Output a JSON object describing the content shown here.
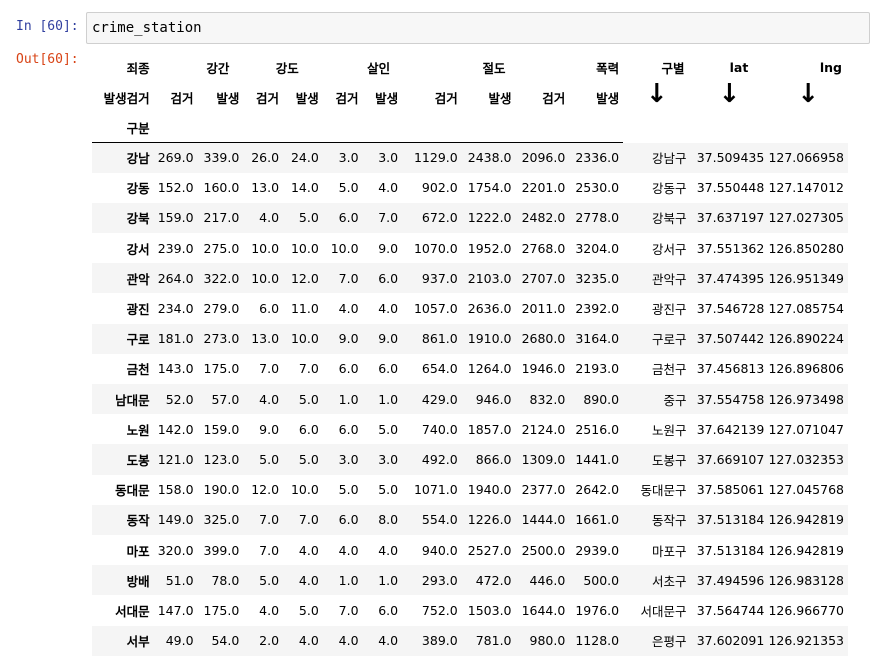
{
  "input": {
    "prompt": "In [60]:",
    "code": "crime_station"
  },
  "output": {
    "prompt": "Out[60]:"
  },
  "table": {
    "header_row1": [
      "죄종",
      "강간",
      "강도",
      "살인",
      "절도",
      "폭력",
      "구별",
      "lat",
      "lng"
    ],
    "header_row2": [
      "발생검거",
      "검거",
      "발생",
      "검거",
      "발생",
      "검거",
      "발생",
      "검거",
      "발생",
      "검거",
      "발생"
    ],
    "index_name": "구분",
    "arrow_glyph": "↓",
    "rows": [
      [
        "강남",
        "269.0",
        "339.0",
        "26.0",
        "24.0",
        "3.0",
        "3.0",
        "1129.0",
        "2438.0",
        "2096.0",
        "2336.0",
        "강남구",
        "37.509435",
        "127.066958"
      ],
      [
        "강동",
        "152.0",
        "160.0",
        "13.0",
        "14.0",
        "5.0",
        "4.0",
        "902.0",
        "1754.0",
        "2201.0",
        "2530.0",
        "강동구",
        "37.550448",
        "127.147012"
      ],
      [
        "강북",
        "159.0",
        "217.0",
        "4.0",
        "5.0",
        "6.0",
        "7.0",
        "672.0",
        "1222.0",
        "2482.0",
        "2778.0",
        "강북구",
        "37.637197",
        "127.027305"
      ],
      [
        "강서",
        "239.0",
        "275.0",
        "10.0",
        "10.0",
        "10.0",
        "9.0",
        "1070.0",
        "1952.0",
        "2768.0",
        "3204.0",
        "강서구",
        "37.551362",
        "126.850280"
      ],
      [
        "관악",
        "264.0",
        "322.0",
        "10.0",
        "12.0",
        "7.0",
        "6.0",
        "937.0",
        "2103.0",
        "2707.0",
        "3235.0",
        "관악구",
        "37.474395",
        "126.951349"
      ],
      [
        "광진",
        "234.0",
        "279.0",
        "6.0",
        "11.0",
        "4.0",
        "4.0",
        "1057.0",
        "2636.0",
        "2011.0",
        "2392.0",
        "광진구",
        "37.546728",
        "127.085754"
      ],
      [
        "구로",
        "181.0",
        "273.0",
        "13.0",
        "10.0",
        "9.0",
        "9.0",
        "861.0",
        "1910.0",
        "2680.0",
        "3164.0",
        "구로구",
        "37.507442",
        "126.890224"
      ],
      [
        "금천",
        "143.0",
        "175.0",
        "7.0",
        "7.0",
        "6.0",
        "6.0",
        "654.0",
        "1264.0",
        "1946.0",
        "2193.0",
        "금천구",
        "37.456813",
        "126.896806"
      ],
      [
        "남대문",
        "52.0",
        "57.0",
        "4.0",
        "5.0",
        "1.0",
        "1.0",
        "429.0",
        "946.0",
        "832.0",
        "890.0",
        "중구",
        "37.554758",
        "126.973498"
      ],
      [
        "노원",
        "142.0",
        "159.0",
        "9.0",
        "6.0",
        "6.0",
        "5.0",
        "740.0",
        "1857.0",
        "2124.0",
        "2516.0",
        "노원구",
        "37.642139",
        "127.071047"
      ],
      [
        "도봉",
        "121.0",
        "123.0",
        "5.0",
        "5.0",
        "3.0",
        "3.0",
        "492.0",
        "866.0",
        "1309.0",
        "1441.0",
        "도봉구",
        "37.669107",
        "127.032353"
      ],
      [
        "동대문",
        "158.0",
        "190.0",
        "12.0",
        "10.0",
        "5.0",
        "5.0",
        "1071.0",
        "1940.0",
        "2377.0",
        "2642.0",
        "동대문구",
        "37.585061",
        "127.045768"
      ],
      [
        "동작",
        "149.0",
        "325.0",
        "7.0",
        "7.0",
        "6.0",
        "8.0",
        "554.0",
        "1226.0",
        "1444.0",
        "1661.0",
        "동작구",
        "37.513184",
        "126.942819"
      ],
      [
        "마포",
        "320.0",
        "399.0",
        "7.0",
        "4.0",
        "4.0",
        "4.0",
        "940.0",
        "2527.0",
        "2500.0",
        "2939.0",
        "마포구",
        "37.513184",
        "126.942819"
      ],
      [
        "방배",
        "51.0",
        "78.0",
        "5.0",
        "4.0",
        "1.0",
        "1.0",
        "293.0",
        "472.0",
        "446.0",
        "500.0",
        "서초구",
        "37.494596",
        "126.983128"
      ],
      [
        "서대문",
        "147.0",
        "175.0",
        "4.0",
        "5.0",
        "7.0",
        "6.0",
        "752.0",
        "1503.0",
        "1644.0",
        "1976.0",
        "서대문구",
        "37.564744",
        "126.966770"
      ],
      [
        "서부",
        "49.0",
        "54.0",
        "2.0",
        "4.0",
        "4.0",
        "4.0",
        "389.0",
        "781.0",
        "980.0",
        "1128.0",
        "은평구",
        "37.602091",
        "126.921353"
      ]
    ]
  }
}
